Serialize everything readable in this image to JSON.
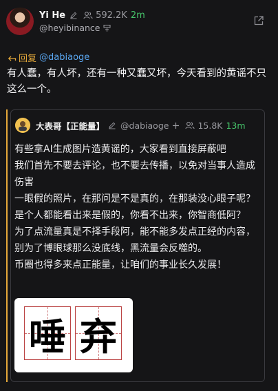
{
  "author": {
    "name": "Yi He",
    "handle": "@heyibinance",
    "followers": "592.2K",
    "time": "2m"
  },
  "reply": {
    "label": "回复",
    "to_handle": "@dabiaoge"
  },
  "post_text": "有人蠢，有人坏，还有一种又蠢又坏，今天看到的黄谣不只这么一个。",
  "quoted": {
    "name": "大表哥【正能量】",
    "handle": "@dabiaoge",
    "followers": "15.8K",
    "time": "13m",
    "paragraphs": [
      "有些拿AI生成图片造黄谣的，大家看到直接屏蔽吧",
      "我们首先不要去评论，也不要去传播，以免对当事人造成伤害",
      "一眼假的照片，在那问是不是真的，在那装没心眼子呢？是个人都能看出来是假的，你看不出来，你智商低阿？",
      "为了点流量真是不择手段阿，能不能多发点正经的内容，别为了博眼球那么没底线，黑流量会反噬的。",
      "币圈也得多来点正能量，让咱们的事业长久发展！"
    ],
    "image_glyphs": [
      "唾",
      "弃"
    ]
  },
  "colors": {
    "background": "#151517",
    "accent_orange": "#e5a93a",
    "link_blue": "#5aa6f0",
    "time_green": "#46c46a"
  },
  "icons": {
    "edit": "pencil-icon",
    "followers": "users-icon",
    "badge": "org-badge-icon",
    "share": "external-link-icon",
    "reply": "reply-arrow-icon",
    "follow": "plus-icon"
  }
}
